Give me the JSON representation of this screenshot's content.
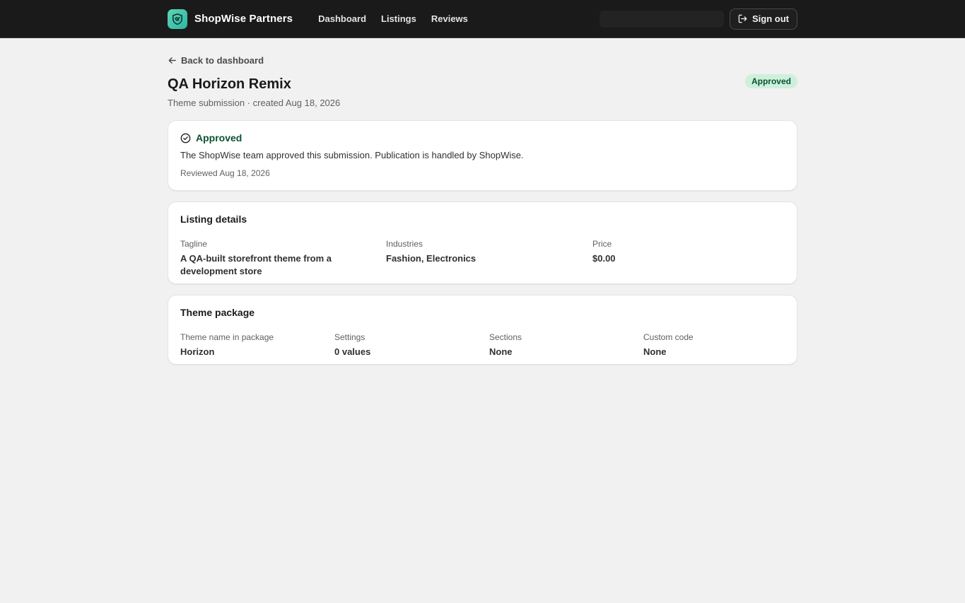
{
  "header": {
    "brand": "ShopWise Partners",
    "nav": [
      "Dashboard",
      "Listings",
      "Reviews"
    ],
    "sign_out": "Sign out"
  },
  "page": {
    "back_link": "Back to dashboard",
    "title": "QA Horizon Remix",
    "status_badge": "Approved",
    "subtitle": "Theme submission · created Aug 18, 2026"
  },
  "status_card": {
    "title": "Approved",
    "message": "The ShopWise team approved this submission. Publication is handled by ShopWise.",
    "reviewed": "Reviewed Aug 18, 2026"
  },
  "listing_details": {
    "title": "Listing details",
    "fields": [
      {
        "label": "Tagline",
        "value": "A QA-built storefront theme from a development store"
      },
      {
        "label": "Industries",
        "value": "Fashion, Electronics"
      },
      {
        "label": "Price",
        "value": "$0.00"
      }
    ]
  },
  "theme_package": {
    "title": "Theme package",
    "fields": [
      {
        "label": "Theme name in package",
        "value": "Horizon"
      },
      {
        "label": "Settings",
        "value": "0 values"
      },
      {
        "label": "Sections",
        "value": "None"
      },
      {
        "label": "Custom code",
        "value": "None"
      }
    ]
  },
  "colors": {
    "topbar": "#1a1a1a",
    "approved_text": "#0c5132",
    "approved_bg": "#cdf0dc",
    "logo": "#2cb8a4"
  },
  "icons": [
    "handshake-shield-icon",
    "sign-out-icon",
    "arrow-left-icon",
    "check-circle-icon"
  ]
}
